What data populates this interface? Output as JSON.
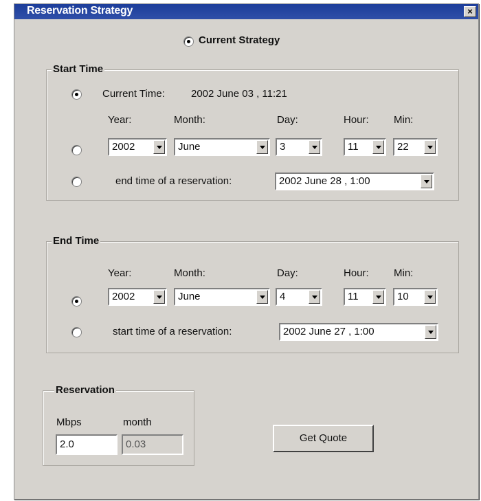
{
  "window": {
    "title": "Reservation Strategy",
    "close_glyph": "×"
  },
  "strategy": {
    "current_strategy_label": "Current Strategy"
  },
  "start_time": {
    "legend": "Start Time",
    "current_time_label": "Current Time:",
    "current_time_value": "2002 June 03 , 11:21",
    "column_headers": {
      "year": "Year:",
      "month": "Month:",
      "day": "Day:",
      "hour": "Hour:",
      "min": "Min:"
    },
    "year": "2002",
    "month": "June",
    "day": "3",
    "hour": "11",
    "min": "22",
    "end_reservation_label": "end time of a reservation:",
    "end_reservation_value": "2002 June 28 , 1:00"
  },
  "end_time": {
    "legend": "End Time",
    "column_headers": {
      "year": "Year:",
      "month": "Month:",
      "day": "Day:",
      "hour": "Hour:",
      "min": "Min:"
    },
    "year": "2002",
    "month": "June",
    "day": "4",
    "hour": "11",
    "min": "10",
    "start_reservation_label": "start time of a reservation:",
    "start_reservation_value": "2002 June 27 , 1:00"
  },
  "reservation": {
    "legend": "Reservation",
    "mbps_label": "Mbps",
    "month_label": "month",
    "mbps_value": "2.0",
    "month_value": "0.03"
  },
  "get_quote_label": "Get Quote",
  "radios": {
    "current_strategy": true,
    "start_current_time": true,
    "start_custom": false,
    "start_end_of_reservation": false,
    "end_custom": true,
    "end_start_of_reservation": false
  }
}
